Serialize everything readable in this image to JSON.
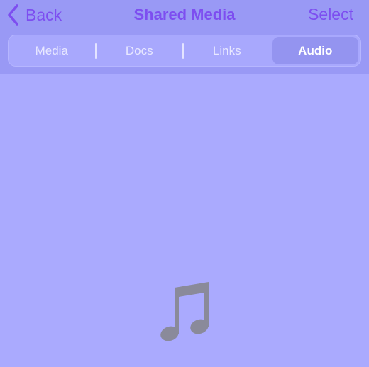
{
  "nav": {
    "back_label": "Back",
    "title": "Shared Media",
    "select_label": "Select"
  },
  "tabs": [
    {
      "label": "Media",
      "active": false
    },
    {
      "label": "Docs",
      "active": false
    },
    {
      "label": "Links",
      "active": false
    },
    {
      "label": "Audio",
      "active": true
    }
  ],
  "empty_state": {
    "icon": "music-note-icon"
  },
  "colors": {
    "accent": "#7d4ef0",
    "background": "#aaaafe",
    "header": "#9999f5"
  }
}
